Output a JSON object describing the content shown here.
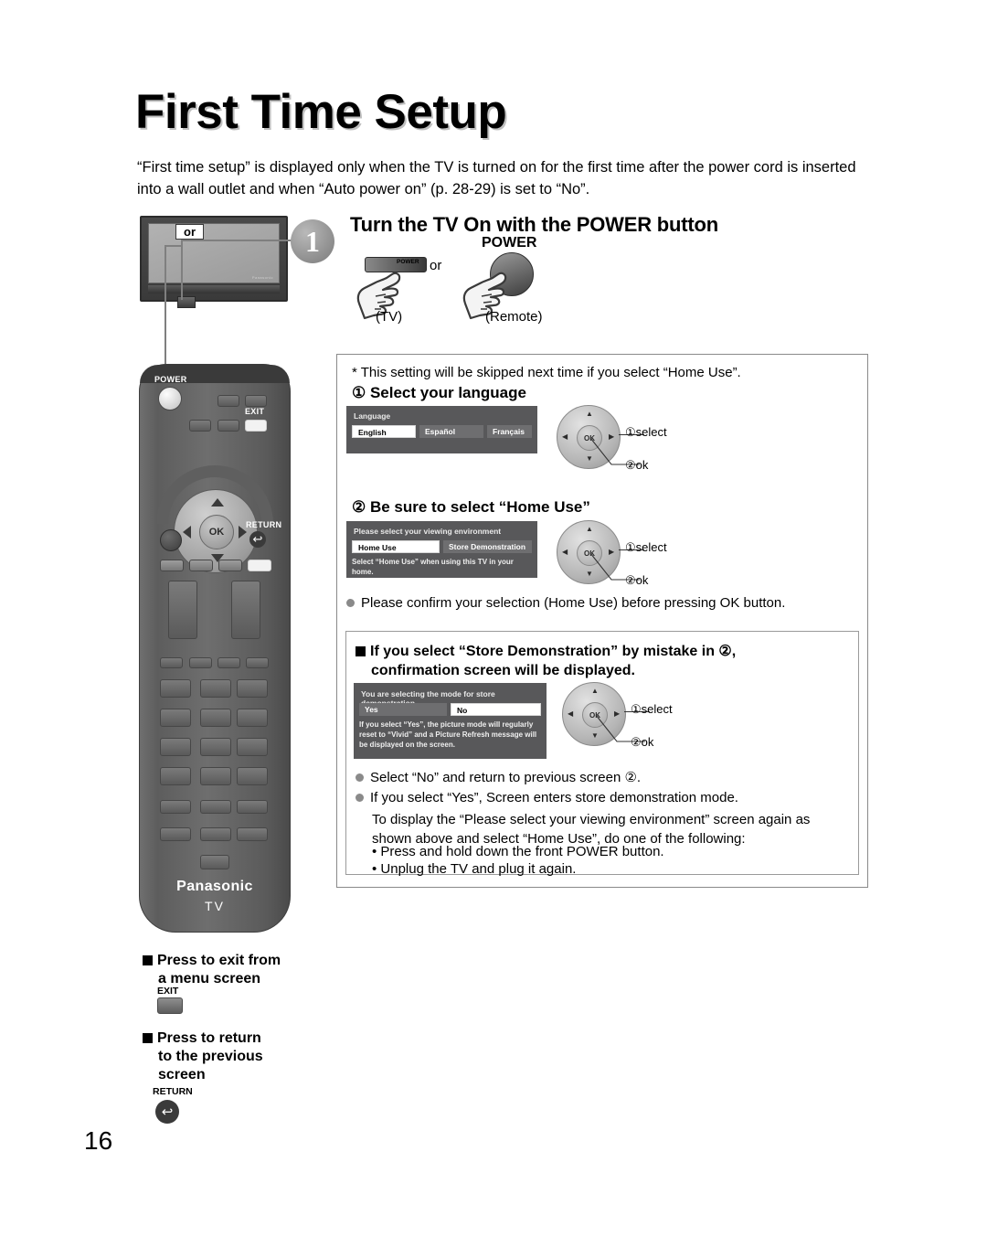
{
  "page": {
    "title": "First Time Setup",
    "number": "16",
    "intro": "“First time setup” is displayed only when the TV is turned on for the first time after the power cord is inserted into a wall outlet and when “Auto power on” (p. 28-29) is set to “No”."
  },
  "step1": {
    "badge": "1",
    "heading": "Turn the TV On with the POWER button",
    "tv_screen_or": "or",
    "tv_brand": "Panasonic",
    "tv_button_label": "POWER",
    "or_label": "or",
    "remote_power_label": "POWER",
    "caption_tv": "(TV)",
    "caption_remote": "(Remote)"
  },
  "remote": {
    "power_label": "POWER",
    "exit_label": "EXIT",
    "ok_label": "OK",
    "return_label": "RETURN",
    "return_icon": "↩",
    "brand": "Panasonic",
    "brand_sub": "TV"
  },
  "mainbox": {
    "note": "* This setting will be skipped next time if you select “Home Use”.",
    "section1": {
      "heading": "① Select your language",
      "osd": {
        "title": "Language",
        "options": [
          "English",
          "Español",
          "Français"
        ],
        "selected": "English"
      },
      "pad": {
        "ok": "OK",
        "up": "▲",
        "down": "▼",
        "left": "◀",
        "right": "▶",
        "label_select": "①select",
        "label_ok": "②ok"
      }
    },
    "section2": {
      "heading": "② Be sure to select “Home Use”",
      "osd": {
        "title": "Please select your viewing environment",
        "options": [
          "Home Use",
          "Store Demonstration"
        ],
        "selected": "Home Use",
        "note": "Select “Home Use” when using this TV in your home."
      },
      "pad": {
        "ok": "OK",
        "up": "▲",
        "down": "▼",
        "left": "◀",
        "right": "▶",
        "label_select": "①select",
        "label_ok": "②ok"
      },
      "bullet": "Please confirm your selection (Home Use) before pressing OK button."
    },
    "section3": {
      "heading_line1": "If you select “Store Demonstration” by mistake in ②,",
      "heading_line2": "confirmation screen will be displayed.",
      "osd": {
        "title": "You are selecting the mode for store demonstration",
        "options": [
          "Yes",
          "No"
        ],
        "selected": "No",
        "note": "If you select “Yes”, the picture mode will regularly reset to “Vivid” and a Picture Refresh message will be displayed on the screen."
      },
      "pad": {
        "ok": "OK",
        "up": "▲",
        "down": "▼",
        "left": "◀",
        "right": "▶",
        "label_select": "①select",
        "label_ok": "②ok"
      },
      "bullets": [
        "Select “No” and return to previous screen ②.",
        "If you select “Yes”, Screen enters store demonstration mode."
      ],
      "para1": "To display the “Please select your viewing environment” screen again as shown above and select “Home Use”, do one of the following:",
      "dash1": "• Press and hold down the front POWER button.",
      "dash2": "• Unplug the TV and plug it again."
    }
  },
  "bottom_left": {
    "exit_block": {
      "line1": "Press to exit from",
      "line2": "a menu screen",
      "key_label": "EXIT"
    },
    "return_block": {
      "line1": "Press to return",
      "line2": "to the previous",
      "line3": "screen",
      "key_label": "RETURN",
      "icon": "↩"
    }
  }
}
